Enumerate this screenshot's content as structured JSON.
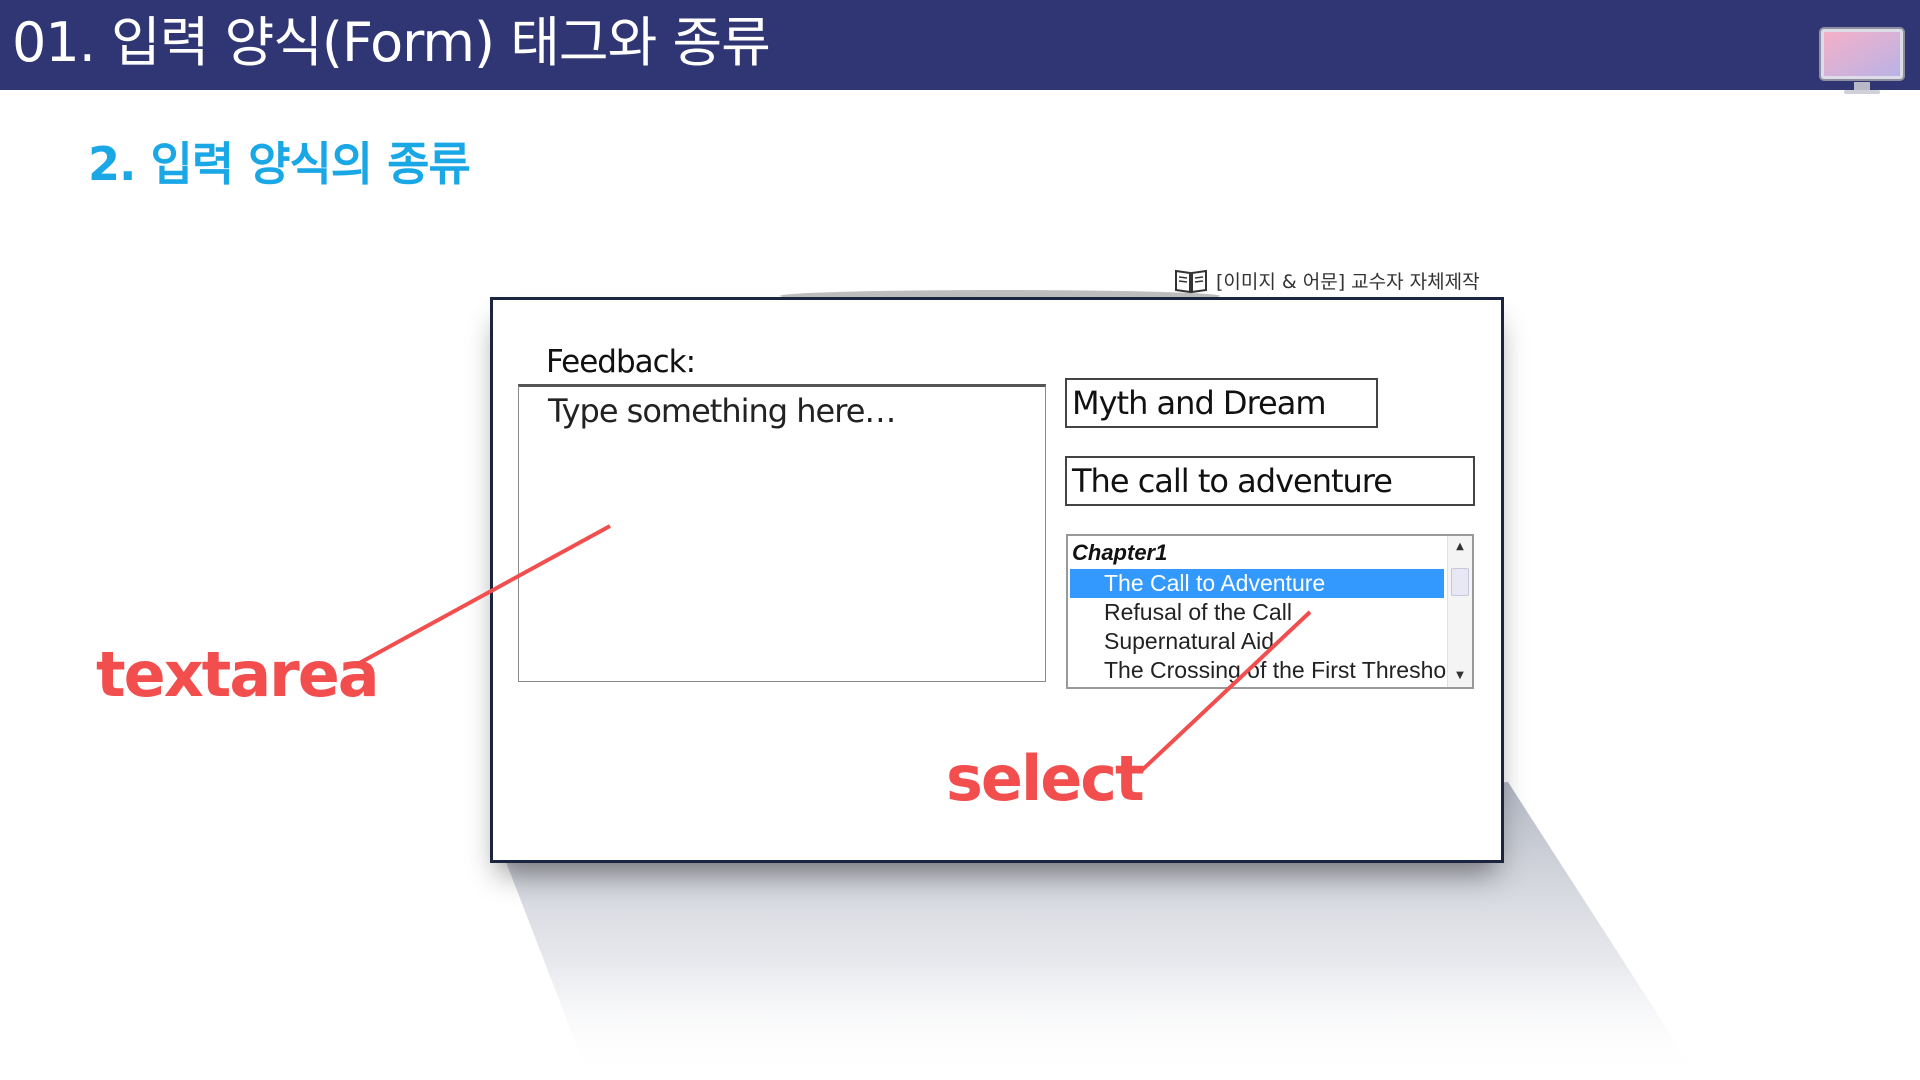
{
  "header": {
    "title": "01. 입력 양식(Form) 태그와 종류",
    "icon": "monitor-icon"
  },
  "section": {
    "title": "2. 입력 양식의 종류"
  },
  "source_note": {
    "icon": "book-icon",
    "text": "[이미지 & 어문] 교수자 자체제작"
  },
  "form": {
    "feedback_label": "Feedback:",
    "textarea_placeholder": "Type something here…",
    "input_1_value": "Myth and Dream",
    "input_2_value": "The call to adventure",
    "select": {
      "group_label": "Chapter1",
      "options": [
        "The Call to Adventure",
        "Refusal of the Call",
        "Supernatural Aid",
        "The Crossing of the First Threshold"
      ],
      "selected_index": 0
    }
  },
  "callouts": {
    "textarea_label": "textarea",
    "select_label": "select"
  },
  "colors": {
    "header_bg": "#2f3673",
    "section_title": "#1aa7e6",
    "callout": "#f24e4e",
    "selected_option": "#3399ff"
  }
}
